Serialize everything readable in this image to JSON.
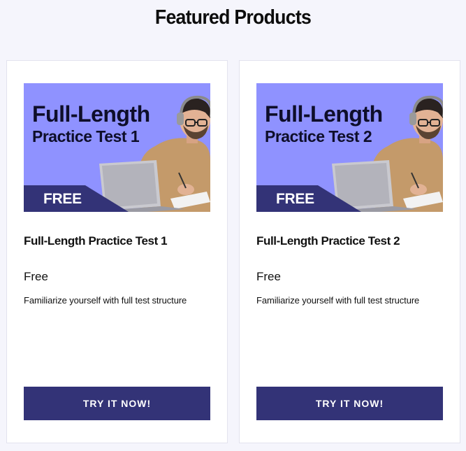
{
  "section": {
    "title": "Featured Products"
  },
  "products": [
    {
      "thumb_title_line1": "Full-Length",
      "thumb_title_line2": "Practice Test 1",
      "badge": "FREE",
      "name": "Full-Length Practice Test 1",
      "price": "Free",
      "description": "Familiarize yourself with full test structure",
      "cta": "TRY IT NOW!"
    },
    {
      "thumb_title_line1": "Full-Length",
      "thumb_title_line2": "Practice Test 2",
      "badge": "FREE",
      "name": "Full-Length Practice Test 2",
      "price": "Free",
      "description": "Familiarize yourself with full test structure",
      "cta": "TRY IT NOW!"
    }
  ],
  "colors": {
    "page_bg": "#f5f5fc",
    "thumb_bg": "#8f92ff",
    "badge_bg": "#333377",
    "button_bg": "#333377",
    "button_text": "#ffffff"
  },
  "icons": {
    "thumbnail_photo": "student-with-laptop"
  }
}
